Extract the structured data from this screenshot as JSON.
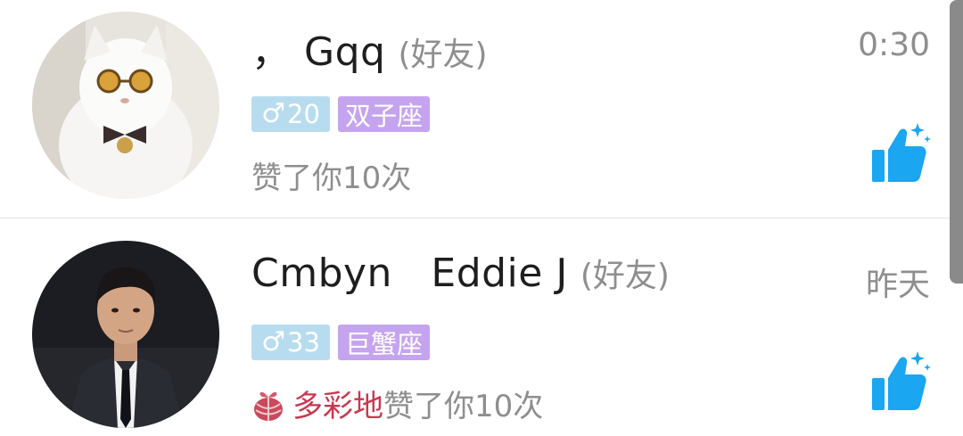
{
  "conversations": [
    {
      "name": "， Gqq",
      "relation": "(好友)",
      "time": "0:30",
      "gender_symbol": "♂",
      "age": "20",
      "zodiac": "双子座",
      "gift_name": "",
      "action_text": "赞了你10次",
      "avatar_icon": "white-cat-with-sunglasses-avatar",
      "like_icon": "thumbs-up-sparkle-icon"
    },
    {
      "name": "Cmbyn   Eddie J",
      "relation": "(好友)",
      "time": "昨天",
      "gender_symbol": "♂",
      "age": "33",
      "zodiac": "巨蟹座",
      "gift_name": "多彩地",
      "action_text": "赞了你10次",
      "avatar_icon": "man-in-suit-avatar",
      "like_icon": "thumbs-up-sparkle-icon",
      "gift_icon": "gift-box-icon"
    }
  ],
  "colors": {
    "gender_tag": "#b8dcef",
    "zodiac_tag": "#c5a4ef",
    "like_icon": "#1aa6f0",
    "gift_text": "#c8384f",
    "muted_text": "#8e8e8e"
  }
}
